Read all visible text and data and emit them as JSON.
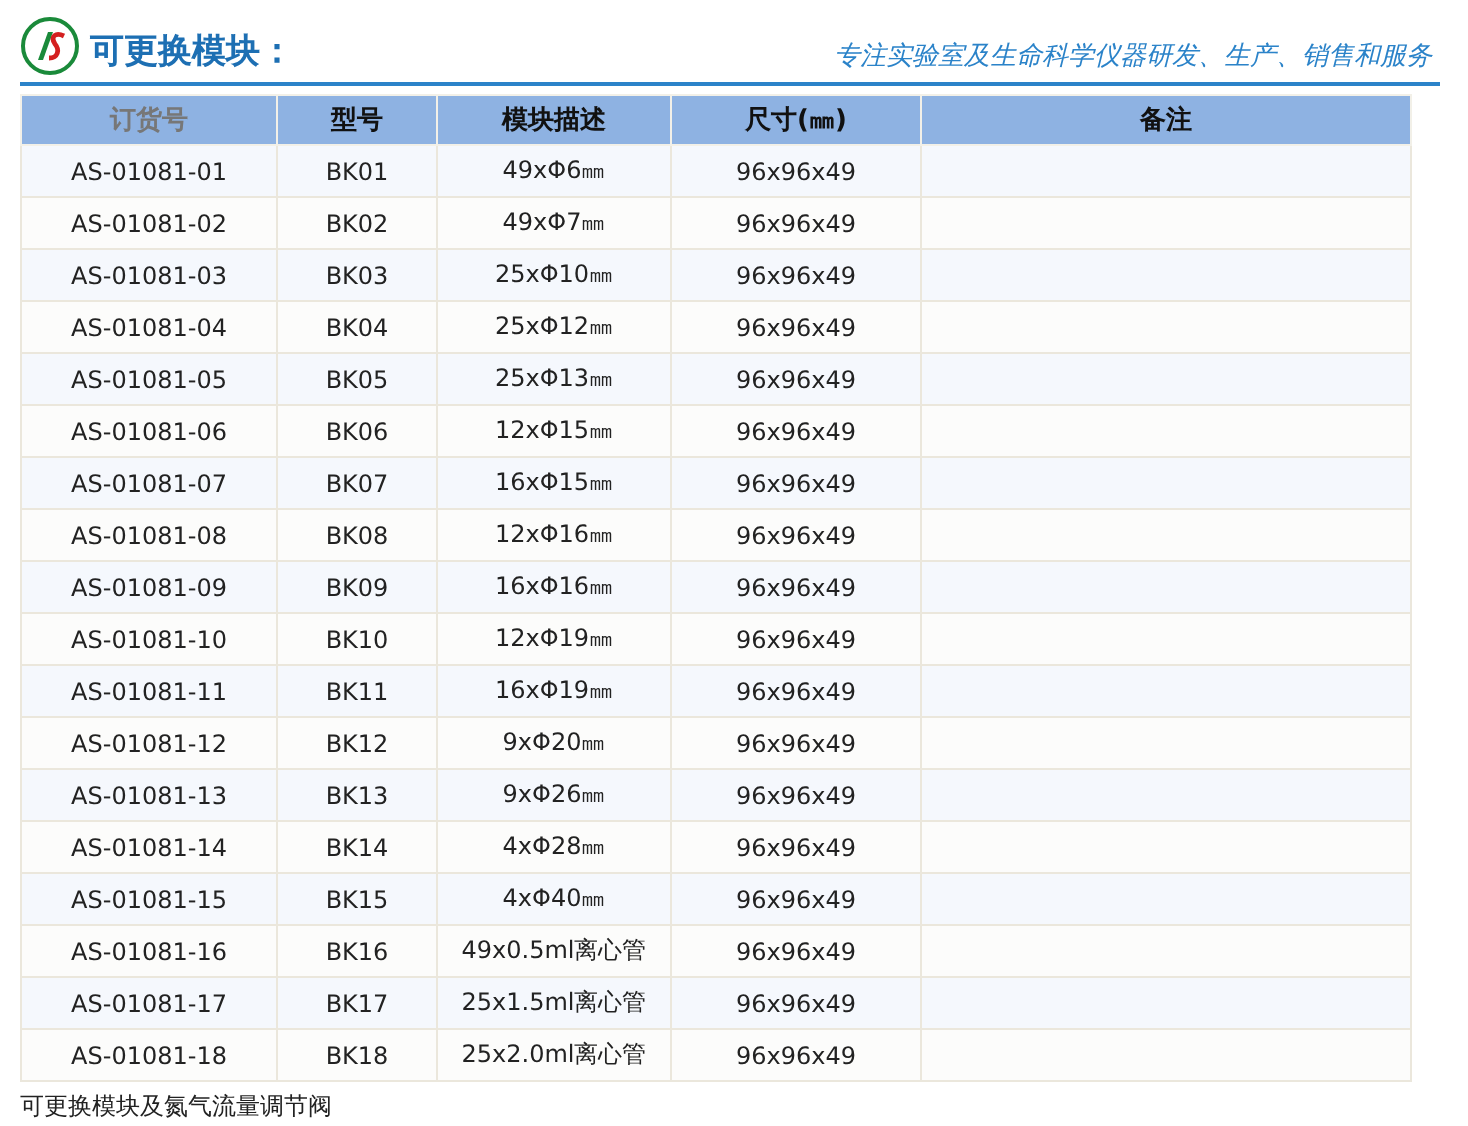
{
  "header": {
    "title": "可更换模块：",
    "slogan": "专注实验室及生命科学仪器研发、生产、销售和服务"
  },
  "table": {
    "columns": [
      {
        "label": "订货号",
        "dimmed": true
      },
      {
        "label": "型号",
        "dimmed": false
      },
      {
        "label": "模块描述",
        "dimmed": false
      },
      {
        "label": "尺寸(㎜)",
        "dimmed": false
      },
      {
        "label": "备注",
        "dimmed": false
      }
    ],
    "rows": [
      [
        "AS-01081-01",
        "BK01",
        "49xΦ6㎜",
        "96x96x49"
      ],
      [
        "AS-01081-02",
        "BK02",
        "49xΦ7㎜",
        "96x96x49"
      ],
      [
        "AS-01081-03",
        "BK03",
        "25xΦ10㎜",
        "96x96x49"
      ],
      [
        "AS-01081-04",
        "BK04",
        "25xΦ12㎜",
        "96x96x49"
      ],
      [
        "AS-01081-05",
        "BK05",
        "25xΦ13㎜",
        "96x96x49"
      ],
      [
        "AS-01081-06",
        "BK06",
        "12xΦ15㎜",
        "96x96x49"
      ],
      [
        "AS-01081-07",
        "BK07",
        "16xΦ15㎜",
        "96x96x49"
      ],
      [
        "AS-01081-08",
        "BK08",
        "12xΦ16㎜",
        "96x96x49"
      ],
      [
        "AS-01081-09",
        "BK09",
        "16xΦ16㎜",
        "96x96x49"
      ],
      [
        "AS-01081-10",
        "BK10",
        "12xΦ19㎜",
        "96x96x49"
      ],
      [
        "AS-01081-11",
        "BK11",
        "16xΦ19㎜",
        "96x96x49"
      ],
      [
        "AS-01081-12",
        "BK12",
        "9xΦ20㎜",
        "96x96x49"
      ],
      [
        "AS-01081-13",
        "BK13",
        "9xΦ26㎜",
        "96x96x49"
      ],
      [
        "AS-01081-14",
        "BK14",
        "4xΦ28㎜",
        "96x96x49"
      ],
      [
        "AS-01081-15",
        "BK15",
        "4xΦ40㎜",
        "96x96x49"
      ],
      [
        "AS-01081-16",
        "BK16",
        "49x0.5ml离心管",
        "96x96x49"
      ],
      [
        "AS-01081-17",
        "BK17",
        "25x1.5ml离心管",
        "96x96x49"
      ],
      [
        "AS-01081-18",
        "BK18",
        "25x2.0ml离心管",
        "96x96x49"
      ]
    ]
  },
  "caption": "可更换模块及氮气流量调节阀"
}
